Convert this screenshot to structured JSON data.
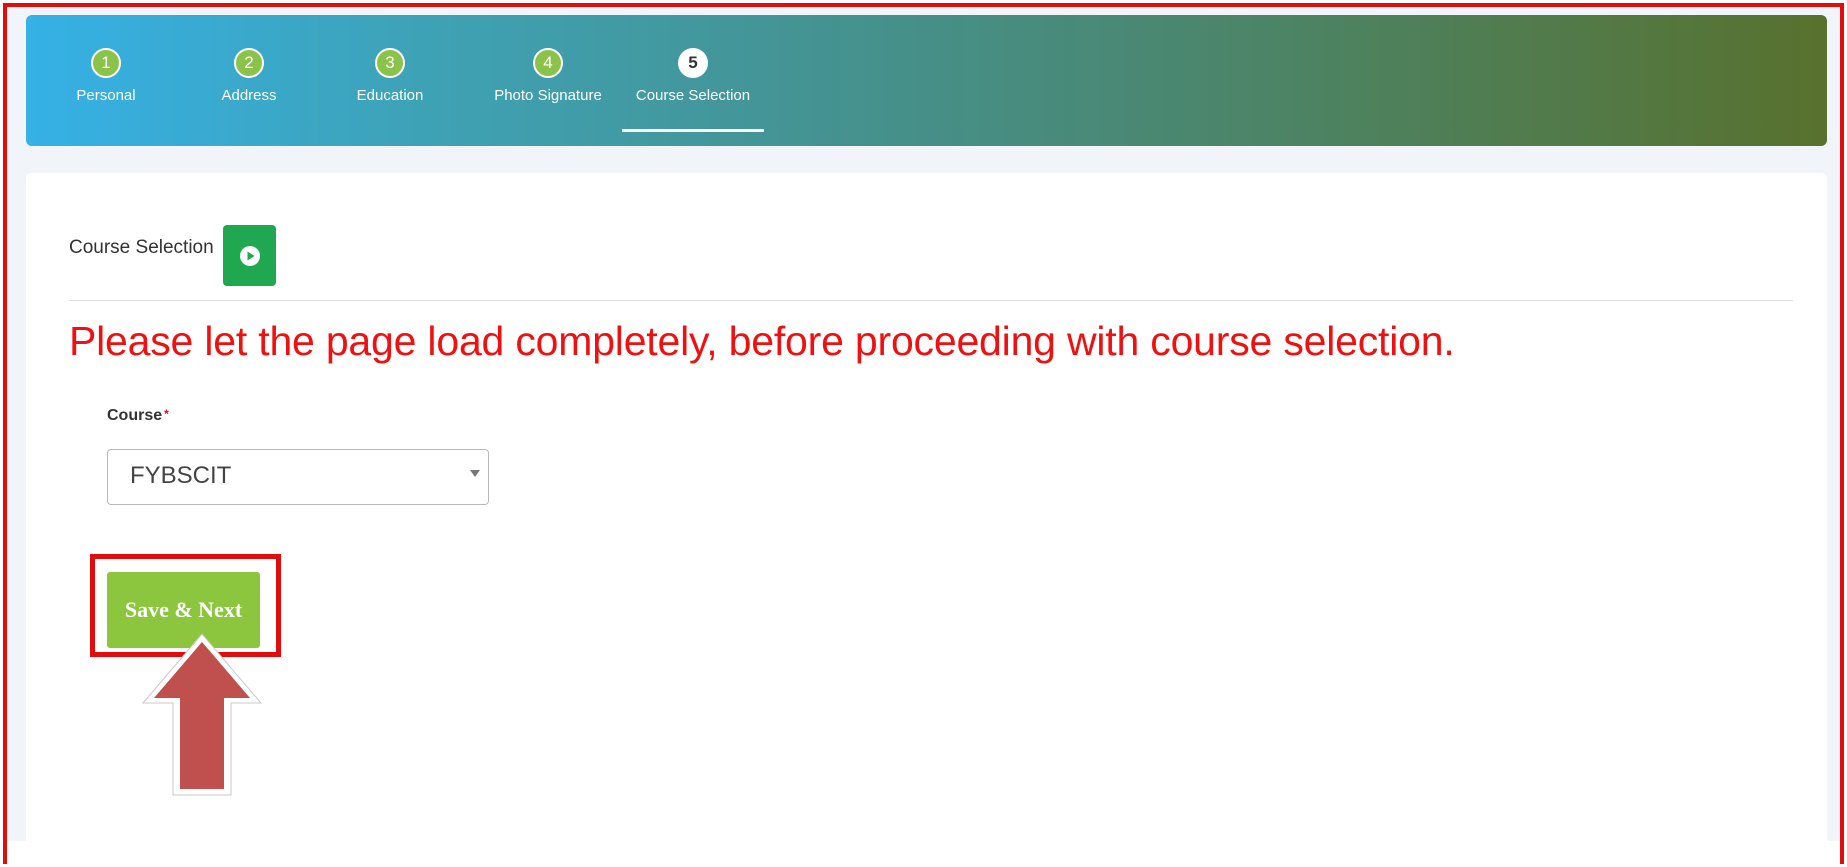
{
  "stepper": {
    "steps": [
      {
        "number": "1",
        "label": "Personal"
      },
      {
        "number": "2",
        "label": "Address"
      },
      {
        "number": "3",
        "label": "Education"
      },
      {
        "number": "4",
        "label": "Photo Signature"
      },
      {
        "number": "5",
        "label": "Course Selection"
      }
    ],
    "active_step": "5"
  },
  "section": {
    "title": "Course Selection",
    "play_icon": "play-circle-icon"
  },
  "warning": {
    "text": "Please let the page load completely, before proceeding with course selection."
  },
  "course_field": {
    "label": "Course",
    "required_marker": "*",
    "selected_value": "FYBSCIT"
  },
  "actions": {
    "save_next_label": "Save & Next"
  },
  "colors": {
    "header_gradient_start": "#35b1e6",
    "header_gradient_end": "#58712d",
    "step_done": "#8bc34a",
    "play_button": "#1fa84f",
    "warning_text": "#ee1111",
    "save_button": "#8cc63f",
    "annotation_red": "#e10d0d",
    "annotation_arrow": "#c0504d"
  },
  "annotations": {
    "arrow_icon": "up-arrow-icon"
  }
}
